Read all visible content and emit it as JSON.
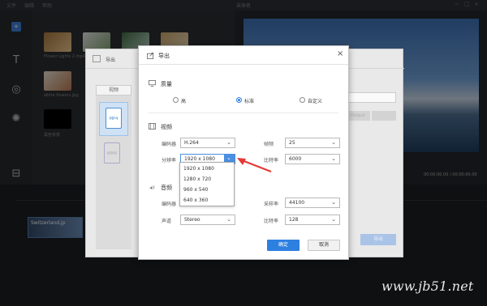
{
  "app": {
    "window_title": "未命名"
  },
  "editor": {
    "menu": [
      "文件",
      "编辑",
      "帮助"
    ],
    "media_captions": [
      "Flower Lights 2.mp4",
      "white flowers.jpg",
      "黑色背景"
    ],
    "preview_time": "00:00:00.00 / 00:00:00.00",
    "clip_label": "Switzerland.jp"
  },
  "bg_dialog": {
    "title": "导出",
    "tab_label": "视频",
    "format_mp4": "MP4",
    "format_other": "WMV",
    "ghost_button": "Output",
    "export_label": "导出"
  },
  "dialog": {
    "title": "导出",
    "close_glyph": "×",
    "quality": {
      "title": "质量",
      "options": [
        {
          "label": "高",
          "selected": false
        },
        {
          "label": "标准",
          "selected": true
        },
        {
          "label": "自定义",
          "selected": false
        }
      ]
    },
    "video": {
      "title": "视频",
      "encoder_label": "编码器",
      "encoder_value": "H.264",
      "framerate_label": "帧频",
      "framerate_value": "25",
      "resolution_label": "分辨率",
      "resolution_value": "1920 x 1080",
      "bitrate_label": "比特率",
      "bitrate_value": "6000",
      "resolution_options": [
        "1920 x 1080",
        "1280 x 720",
        "960 x 540",
        "640 x 360"
      ]
    },
    "audio": {
      "title": "音频",
      "encoder_label": "编码器",
      "channel_label": "声道",
      "channel_value": "Stereo",
      "samplerate_label": "采样率",
      "samplerate_value": "44100",
      "bitrate_label": "比特率",
      "bitrate_value": "128"
    },
    "ok_label": "确定",
    "cancel_label": "取消"
  },
  "annotation": {
    "arrow_color": "#e53935"
  },
  "watermark": "www.jb51.net",
  "colors": {
    "accent": "#2d7fe0",
    "dialog_bg": "#ffffff",
    "editor_bg": "#1e2226"
  }
}
